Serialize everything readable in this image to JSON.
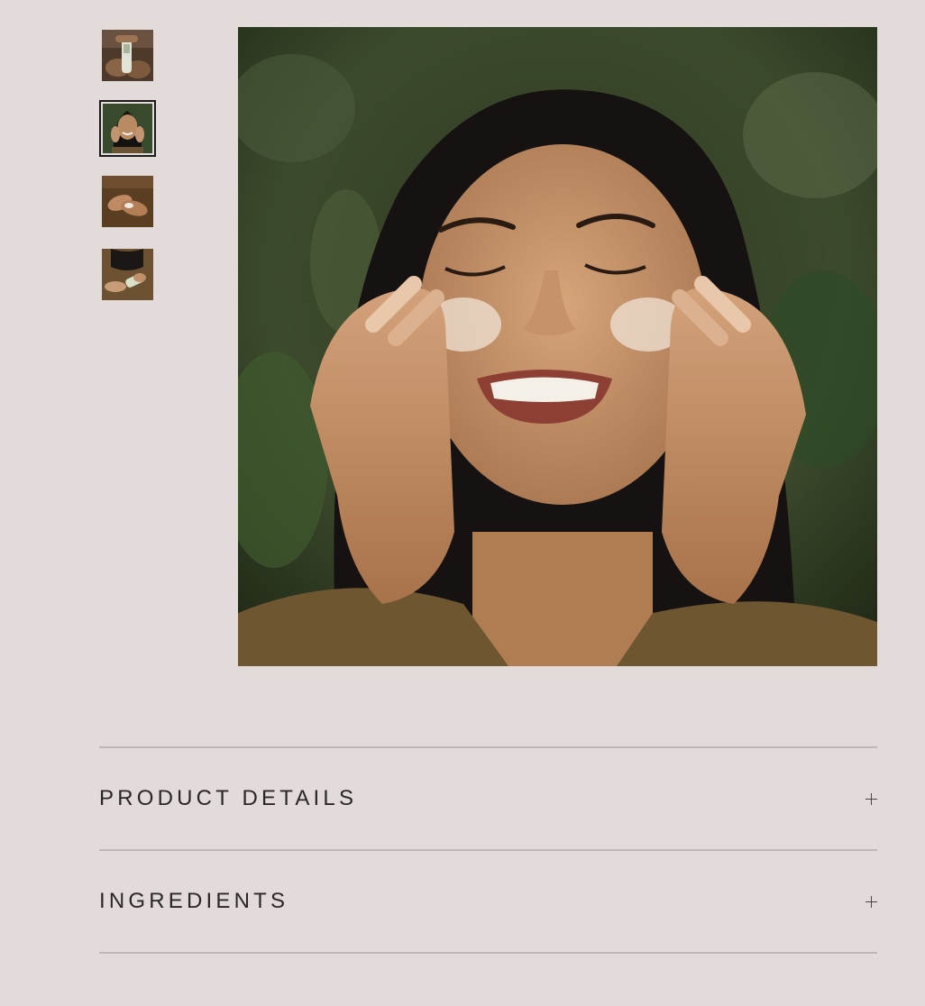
{
  "gallery": {
    "thumbnails": [
      {
        "label": "product bottle in hands",
        "selected": false
      },
      {
        "label": "woman applying cream",
        "selected": true
      },
      {
        "label": "hands with lotion",
        "selected": false
      },
      {
        "label": "holding tube",
        "selected": false
      }
    ],
    "main_image": "woman smiling applying face cream"
  },
  "accordion": {
    "items": [
      {
        "title": "PRODUCT DETAILS",
        "icon": "plus-icon"
      },
      {
        "title": "INGREDIENTS",
        "icon": "plus-icon"
      }
    ]
  },
  "colors": {
    "background": "#e2dbd9",
    "divider": "#bdb7b5",
    "text": "#2a2827"
  }
}
